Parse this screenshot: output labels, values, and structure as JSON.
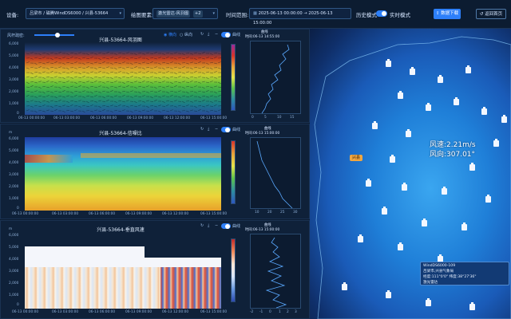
{
  "toolbar": {
    "device_label": "设备:",
    "device_value": "吕梁市 / 磁腾WindDS6000 / 兴县-53664",
    "elements_label": "绘图要素:",
    "elements_tags": [
      "激光雷达-风羽图",
      "+2"
    ],
    "time_label": "时间范围:",
    "time_start": "2025-06-13 00:00:00",
    "time_sep": "→",
    "time_end": "2025-06-13 15:00:00",
    "history_label": "历史模式",
    "realtime_label": "实时模式",
    "download_label": "数据下载",
    "back_label": "返回首页"
  },
  "panels": [
    {
      "title": "兴县-53664-风羽图",
      "wind_density_label": "风杆疏密:",
      "radio_options": [
        "横向",
        "纵向"
      ],
      "curve_label": "曲线",
      "y_unit": "",
      "y_ticks": [
        "6,000",
        "5,000",
        "4,000",
        "3,000",
        "2,000",
        "1,000",
        "0"
      ],
      "x_ticks": [
        "06-13 00:00:00",
        "06-13 03:00:00",
        "06-13 06:00:00",
        "06-13 09:00:00",
        "06-13 12:00:00",
        "06-13 15:00:00"
      ],
      "profile_title": "曲线",
      "profile_time": "时间:06-13 14:55:00",
      "profile_x_ticks": [
        "0",
        "5",
        "10",
        "15"
      ]
    },
    {
      "title": "兴县-53664-信噪比",
      "curve_label": "曲线",
      "y_unit": "m",
      "y_ticks": [
        "6,000",
        "5,000",
        "4,000",
        "3,000",
        "2,000",
        "1,000",
        "0"
      ],
      "x_ticks": [
        "06-13 00:00:00",
        "06-13 03:00:00",
        "06-13 06:00:00",
        "06-13 09:00:00",
        "06-13 12:00:00",
        "06-13 15:00:00"
      ],
      "profile_title": "曲线",
      "profile_time": "时间:06-13 15:00:00",
      "profile_x_ticks": [
        "10",
        "20",
        "25",
        "30"
      ]
    },
    {
      "title": "兴县-53664-垂直风速",
      "curve_label": "曲线",
      "y_unit": "m",
      "y_ticks": [
        "6,000",
        "5,000",
        "4,000",
        "3,000",
        "2,000",
        "1,000",
        "0"
      ],
      "x_ticks": [
        "06-13 00:00:00",
        "06-13 03:00:00",
        "06-13 06:00:00",
        "06-13 09:00:00",
        "06-13 12:00:00",
        "06-13 15:00:00"
      ],
      "profile_title": "曲线",
      "profile_time": "时间:06-13 15:00:00",
      "profile_x_ticks": [
        "-2",
        "-1",
        "0",
        "1",
        "2",
        "3"
      ]
    }
  ],
  "map": {
    "wind_speed": "风速:2.21m/s",
    "wind_dir": "风向:307.01°",
    "highlight_station": "兴县",
    "popup_title": "WindDS6000-109",
    "popup_place": "吕梁市,兴县气象局",
    "popup_coords": "经度:111°0'0\" 纬度:38°27'36\"",
    "popup_type": "激光雷达"
  },
  "colors": {
    "accent": "#2d7ff9",
    "panel_bg": "#0f2139",
    "highlight": "#f0a640"
  }
}
